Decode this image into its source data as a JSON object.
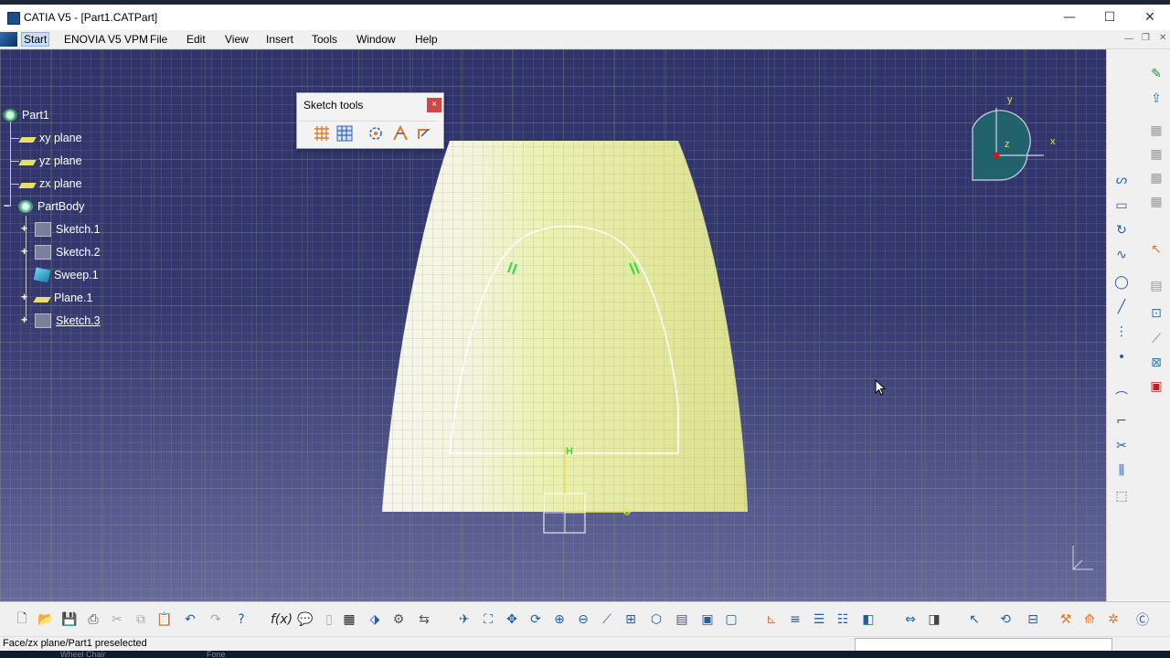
{
  "window": {
    "title": "CATIA V5 - [Part1.CATPart]",
    "minimize": "—",
    "maximize": "☐",
    "close": "✕"
  },
  "menu": {
    "items": [
      "Start",
      "ENOVIA V5 VPM",
      "File",
      "Edit",
      "View",
      "Insert",
      "Tools",
      "Window",
      "Help"
    ]
  },
  "tree": {
    "root": "Part1",
    "items": [
      "xy plane",
      "yz plane",
      "zx plane",
      "PartBody",
      "Sketch.1",
      "Sketch.2",
      "Sweep.1",
      "Plane.1",
      "Sketch.3"
    ]
  },
  "sketch_tools": {
    "title": "Sketch tools",
    "close": "×"
  },
  "compass": {
    "y": "y",
    "x": "x",
    "z": "z"
  },
  "sketch": {
    "origin_label": "H"
  },
  "statusbar": {
    "message": "Face/zx plane/Part1 preselected"
  },
  "taskbar": {
    "item1": "Wheel Chair",
    "item2": "Fone"
  },
  "colors": {
    "background": "#30346a",
    "surface": "#e8eca0",
    "sketch_line": "#ffffff",
    "constraint": "#2fd84a",
    "axis": "#e6e24a"
  },
  "icons": {
    "right_toolbar": [
      "sketch-icon",
      "exit-workbench-icon",
      "profile-icon",
      "rectangle-icon",
      "circle-icon",
      "spline-icon",
      "ellipse-icon",
      "line-icon",
      "axis-icon",
      "point-icon",
      "corner-icon",
      "chamfer-icon",
      "trim-icon",
      "mirror-icon",
      "project-3d-icon",
      "select-icon",
      "constraint-icon",
      "contact-constraint-icon",
      "fix-icon",
      "analysis-icon"
    ],
    "bottom_toolbar": [
      "new-icon",
      "open-icon",
      "save-icon",
      "print-icon",
      "cut-icon",
      "copy-icon",
      "paste-icon",
      "undo-icon",
      "redo-icon",
      "whats-this-icon",
      "formula-icon",
      "comment-icon",
      "design-table-icon",
      "catalog-icon",
      "measure-icon",
      "fly-icon",
      "fit-all-icon",
      "pan-icon",
      "rotate-icon",
      "zoom-in-icon",
      "zoom-out-icon",
      "normal-view-icon",
      "quick-view-icon",
      "view-mode-icon",
      "hide-show-icon",
      "swap-space-icon",
      "grid-icon",
      "snap-icon",
      "construction-icon",
      "geometric-constraints-icon",
      "dimensional-constraints-icon",
      "sketch-analysis-icon",
      "update-icon",
      "catia-logo-icon"
    ]
  }
}
